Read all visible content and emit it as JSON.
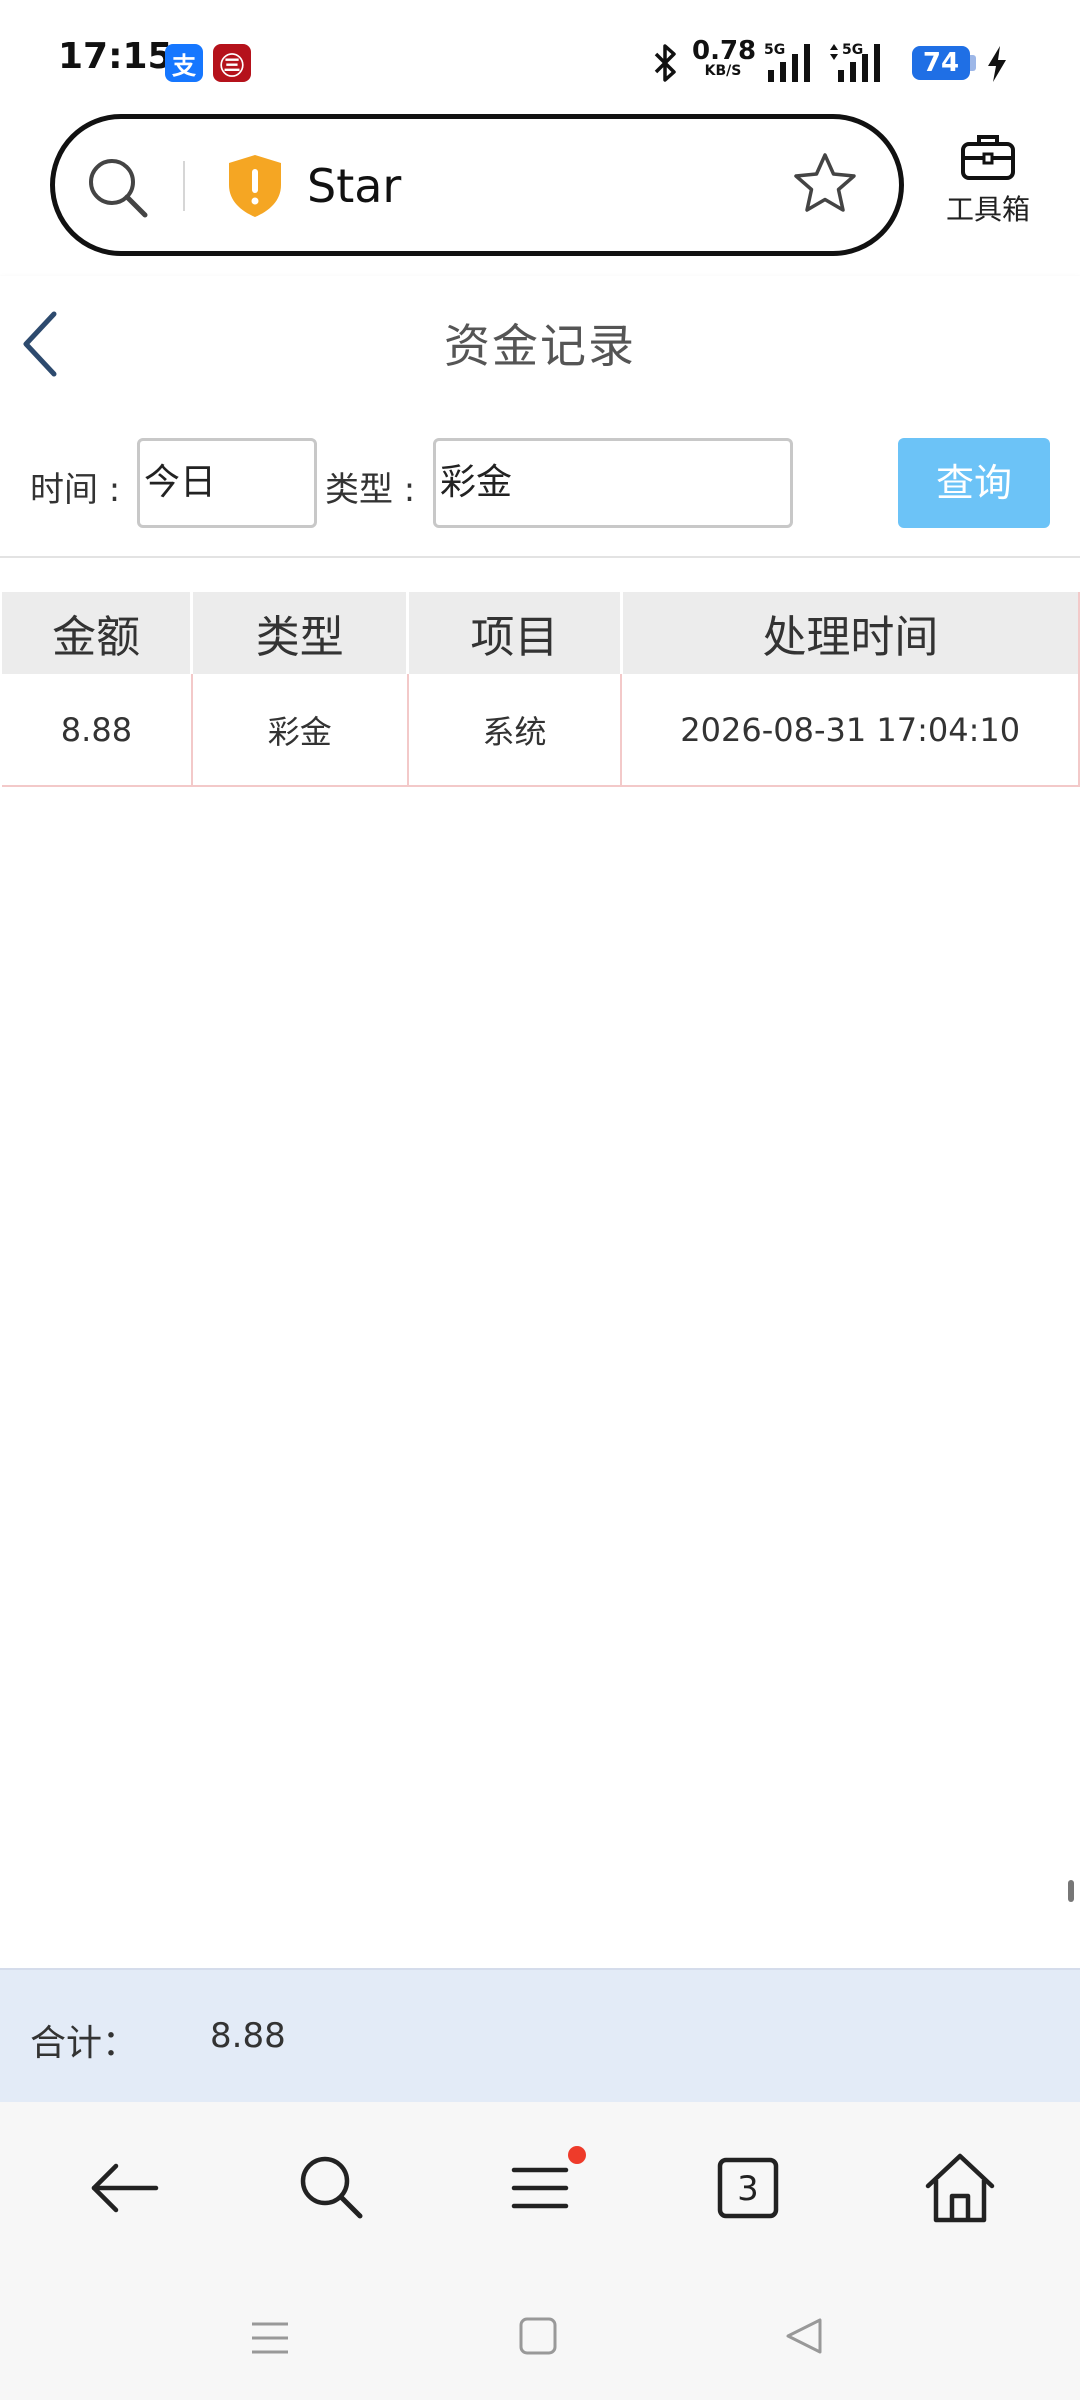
{
  "status_bar": {
    "time": "17:15",
    "app_icons": [
      "支",
      "㊂"
    ],
    "net_speed": "0.78",
    "net_unit": "KB/S",
    "signal_1": "5G",
    "signal_2": "5G",
    "battery": "74",
    "icons": [
      "bluetooth-icon",
      "signal-icon",
      "battery-icon",
      "charging-icon"
    ]
  },
  "address_bar": {
    "url_text": "Star",
    "icons": [
      "search-icon",
      "warning-shield-icon",
      "star-icon"
    ]
  },
  "toolbox": {
    "label": "工具箱"
  },
  "header": {
    "title": "资金记录"
  },
  "filters": {
    "time_label": "时间 :",
    "time_value": "今日",
    "type_label": "类型 :",
    "type_value": "彩金",
    "query_label": "查询"
  },
  "table": {
    "columns": [
      "金额",
      "类型",
      "项目",
      "处理时间"
    ],
    "rows": [
      {
        "amount": "8.88",
        "type": "彩金",
        "item": "系统",
        "time": "2026-08-31 17:04:10"
      }
    ]
  },
  "summary": {
    "label": "合计：",
    "value": "8.88"
  },
  "browser_toolbar": {
    "tab_count": "3",
    "icons": [
      "back-arrow-icon",
      "search-icon",
      "menu-icon",
      "tabs-icon",
      "home-icon"
    ]
  },
  "system_nav": {
    "icons": [
      "recents-icon",
      "home-square-icon",
      "back-triangle-icon"
    ]
  },
  "colors": {
    "query_button": "#6cc3f7",
    "summary_bg": "#e3ebf7",
    "battery": "#1f6fe5",
    "shield": "#f5a623",
    "notification_dot": "#ee3b2a"
  }
}
